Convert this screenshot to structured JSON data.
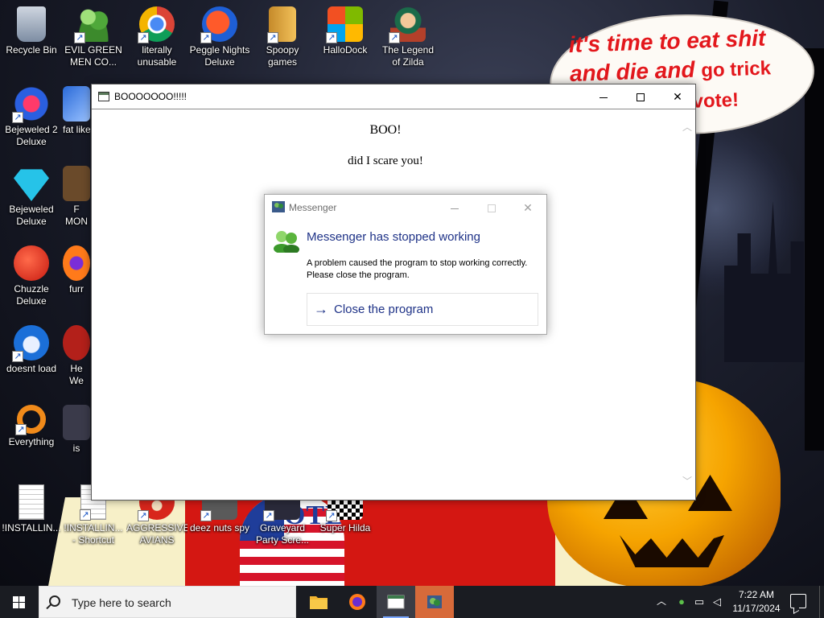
{
  "wallpaper": {
    "speech_balloon_big": "it's time to eat shit and die and",
    "speech_balloon_small": "go trick",
    "speech_balloon_cut": "d vote!",
    "vote_sign": "VOTE"
  },
  "desktop_icons": [
    {
      "label": "Recycle Bin",
      "icon": "recycle-bin-icon"
    },
    {
      "label": "EVIL GREEN MEN CO...",
      "icon": "messenger-buddies-icon"
    },
    {
      "label": "literally unusable",
      "icon": "chrome-icon"
    },
    {
      "label": "Peggle Nights Deluxe",
      "icon": "peggle-icon"
    },
    {
      "label": "Spoopy games",
      "icon": "folder-icon"
    },
    {
      "label": "HalloDock",
      "icon": "windows-logo-icon"
    },
    {
      "label": "The Legend of Zilda",
      "icon": "zelda-icon"
    },
    {
      "label": "Bejeweled 2 Deluxe",
      "icon": "bejeweled2-icon"
    },
    {
      "label": "fat like",
      "icon": "app-icon"
    },
    {
      "label": "Bejeweled Deluxe",
      "icon": "diamond-icon"
    },
    {
      "label": "F MON",
      "icon": "app-icon"
    },
    {
      "label": "Chuzzle Deluxe",
      "icon": "chuzzle-icon"
    },
    {
      "label": "furr",
      "icon": "firefox-icon"
    },
    {
      "label": "doesnt load",
      "icon": "thunderbird-icon"
    },
    {
      "label": "He We",
      "icon": "app-icon"
    },
    {
      "label": "Everything",
      "icon": "search-magnifier-icon"
    },
    {
      "label": "is",
      "icon": "app-icon"
    },
    {
      "label": "!INSTALLIN...",
      "icon": "text-file-icon"
    },
    {
      "label": "!INSTALLIN... - Shortcut",
      "icon": "text-file-shortcut-icon"
    },
    {
      "label": "AGGRESSIVE AVIANS",
      "icon": "angry-bird-icon"
    },
    {
      "label": "deez nuts spy",
      "icon": "app-icon"
    },
    {
      "label": "Graveyard Party Scre...",
      "icon": "app-icon"
    },
    {
      "label": "Super Hilda",
      "icon": "app-icon"
    }
  ],
  "main_window": {
    "title": "BOOOOOOO!!!!!",
    "heading": "BOO!",
    "subheading": "did I scare you!"
  },
  "error_dialog": {
    "title": "Messenger",
    "heading": "Messenger has stopped working",
    "message": "A problem caused the program to stop working correctly. Please close the program.",
    "action_label": "Close the program"
  },
  "taskbar": {
    "search_placeholder": "Type here to search",
    "time": "7:22 AM",
    "date": "11/17/2024"
  },
  "colors": {
    "accent_blue": "#1e3287",
    "taskbar_bg": "#1a1c22",
    "balloon_red": "#e3171c"
  }
}
